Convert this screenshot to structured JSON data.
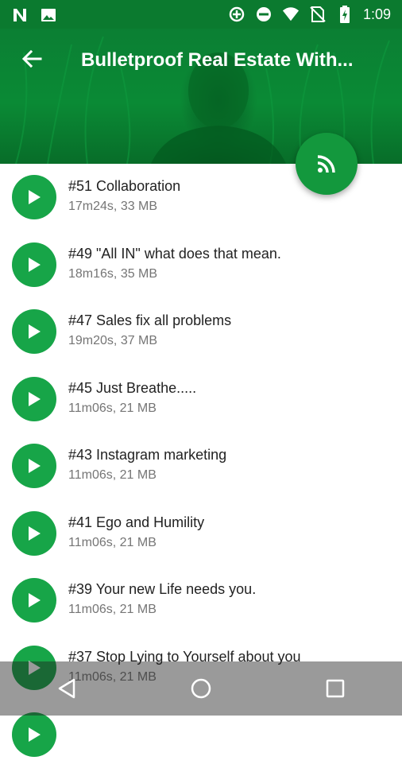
{
  "status_bar": {
    "time": "1:09",
    "left_icons": [
      "n-icon",
      "image-icon"
    ],
    "right_icons": [
      "data-saver-icon",
      "dnd-icon",
      "wifi-icon",
      "no-sim-icon",
      "battery-charging-icon"
    ]
  },
  "header": {
    "title": "Bulletproof Real Estate With...",
    "back_icon": "arrow-back-icon",
    "fab_icon": "rss-feed-icon",
    "color": "#0a8a35"
  },
  "episodes": [
    {
      "title": "#51 Collaboration",
      "meta": "17m24s, 33 MB"
    },
    {
      "title": "#49 \"All IN\" what does that mean.",
      "meta": "18m16s, 35 MB"
    },
    {
      "title": "#47 Sales fix all problems",
      "meta": "19m20s, 37 MB"
    },
    {
      "title": "#45 Just Breathe.....",
      "meta": "11m06s, 21 MB"
    },
    {
      "title": "#43 Instagram marketing",
      "meta": "11m06s, 21 MB"
    },
    {
      "title": "#41 Ego and Humility",
      "meta": "11m06s, 21 MB"
    },
    {
      "title": "#39 Your new Life needs you.",
      "meta": "11m06s, 21 MB"
    },
    {
      "title": "#37 Stop Lying to Yourself about you",
      "meta": "11m06s, 21 MB"
    },
    {
      "title": "",
      "meta": ""
    }
  ],
  "nav_bar": {
    "buttons": [
      "back-triangle-icon",
      "home-circle-icon",
      "recents-square-icon"
    ]
  },
  "colors": {
    "accent": "#17a548",
    "status_bar": "#0b7a2f"
  }
}
